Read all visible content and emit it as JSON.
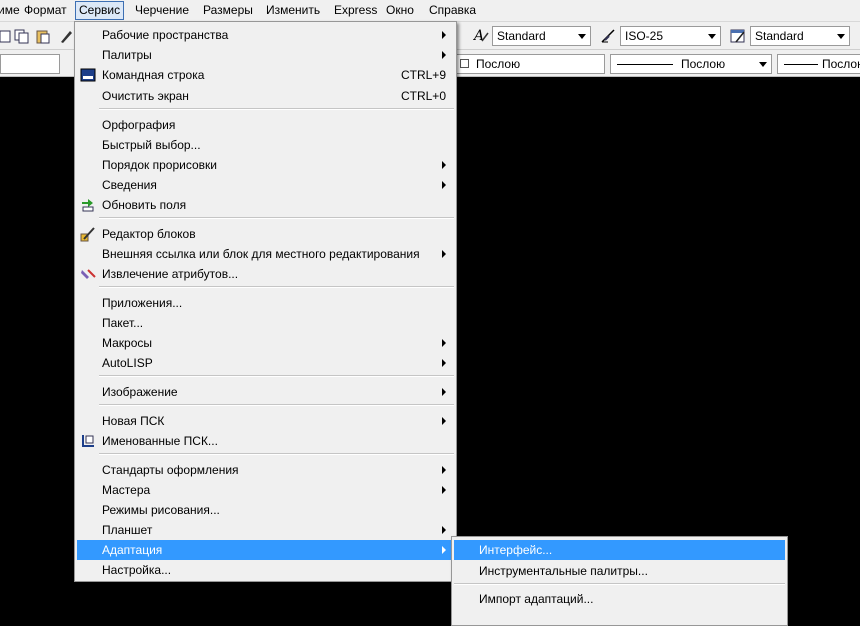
{
  "menubar": {
    "items": [
      {
        "label": "име",
        "open": false
      },
      {
        "label": "Формат",
        "open": false
      },
      {
        "label": "Сервис",
        "open": true
      },
      {
        "label": "Черчение",
        "open": false
      },
      {
        "label": "Размеры",
        "open": false
      },
      {
        "label": "Изменить",
        "open": false
      },
      {
        "label": "Express",
        "open": false
      },
      {
        "label": "Окно",
        "open": false
      },
      {
        "label": "Справка",
        "open": false
      }
    ]
  },
  "toolbar": {
    "text_style": "Standard",
    "dim_style": "ISO-25",
    "table_style": "Standard",
    "color": "Послою",
    "linetype": "Послою",
    "lineweight": "Послою"
  },
  "service_menu": {
    "items": [
      {
        "label": "Рабочие пространства",
        "shortcut": "",
        "submenu": true,
        "icon": ""
      },
      {
        "label": "Палитры",
        "shortcut": "",
        "submenu": true,
        "icon": ""
      },
      {
        "label": "Командная строка",
        "shortcut": "CTRL+9",
        "submenu": false,
        "icon": "command-line-icon"
      },
      {
        "label": "Очистить экран",
        "shortcut": "CTRL+0",
        "submenu": false,
        "icon": ""
      },
      {
        "label": "Орфография",
        "shortcut": "",
        "submenu": false,
        "icon": ""
      },
      {
        "label": "Быстрый выбор...",
        "shortcut": "",
        "submenu": false,
        "icon": ""
      },
      {
        "label": "Порядок прорисовки",
        "shortcut": "",
        "submenu": true,
        "icon": ""
      },
      {
        "label": "Сведения",
        "shortcut": "",
        "submenu": true,
        "icon": ""
      },
      {
        "label": "Обновить поля",
        "shortcut": "",
        "submenu": false,
        "icon": "update-fields-icon"
      },
      {
        "label": "Редактор блоков",
        "shortcut": "",
        "submenu": false,
        "icon": "block-editor-icon"
      },
      {
        "label": "Внешняя ссылка или блок для местного редактирования",
        "shortcut": "",
        "submenu": true,
        "icon": ""
      },
      {
        "label": "Извлечение атрибутов...",
        "shortcut": "",
        "submenu": false,
        "icon": "extract-attributes-icon"
      },
      {
        "label": "Приложения...",
        "shortcut": "",
        "submenu": false,
        "icon": ""
      },
      {
        "label": "Пакет...",
        "shortcut": "",
        "submenu": false,
        "icon": ""
      },
      {
        "label": "Макросы",
        "shortcut": "",
        "submenu": true,
        "icon": ""
      },
      {
        "label": "AutoLISP",
        "shortcut": "",
        "submenu": true,
        "icon": ""
      },
      {
        "label": "Изображение",
        "shortcut": "",
        "submenu": true,
        "icon": ""
      },
      {
        "label": "Новая ПСК",
        "shortcut": "",
        "submenu": true,
        "icon": ""
      },
      {
        "label": "Именованные ПСК...",
        "shortcut": "",
        "submenu": false,
        "icon": "named-ucs-icon"
      },
      {
        "label": "Стандарты оформления",
        "shortcut": "",
        "submenu": true,
        "icon": ""
      },
      {
        "label": "Мастера",
        "shortcut": "",
        "submenu": true,
        "icon": ""
      },
      {
        "label": "Режимы рисования...",
        "shortcut": "",
        "submenu": false,
        "icon": ""
      },
      {
        "label": "Планшет",
        "shortcut": "",
        "submenu": true,
        "icon": ""
      },
      {
        "label": "Адаптация",
        "shortcut": "",
        "submenu": true,
        "icon": "",
        "highlighted": true
      },
      {
        "label": "Настройка...",
        "shortcut": "",
        "submenu": false,
        "icon": ""
      }
    ]
  },
  "customize_submenu": {
    "items": [
      {
        "label": "Интерфейс...",
        "highlighted": true
      },
      {
        "label": "Инструментальные палитры..."
      },
      {
        "label": "Импорт адаптаций..."
      }
    ]
  },
  "colors": {
    "menu_bg": "#f0f0f0",
    "highlight": "#3399ff",
    "canvas": "#000000"
  }
}
